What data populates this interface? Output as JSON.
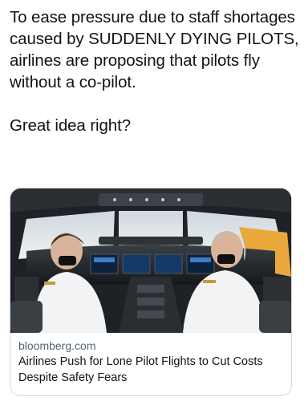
{
  "tweet": {
    "text": "To ease pressure due to staff shortages caused by SUDDENLY DYING PILOTS, airlines are proposing that pilots fly without a co-pilot.\n\nGreat idea right?"
  },
  "link_card": {
    "domain": "bloomberg.com",
    "title": "Airlines Push for Lone Pilot Flights to Cut Costs Despite Safety Fears",
    "image_subject": "two pilots in an airliner cockpit"
  },
  "colors": {
    "text": "#0f1419",
    "secondary": "#536471",
    "border": "#cfd9de"
  }
}
